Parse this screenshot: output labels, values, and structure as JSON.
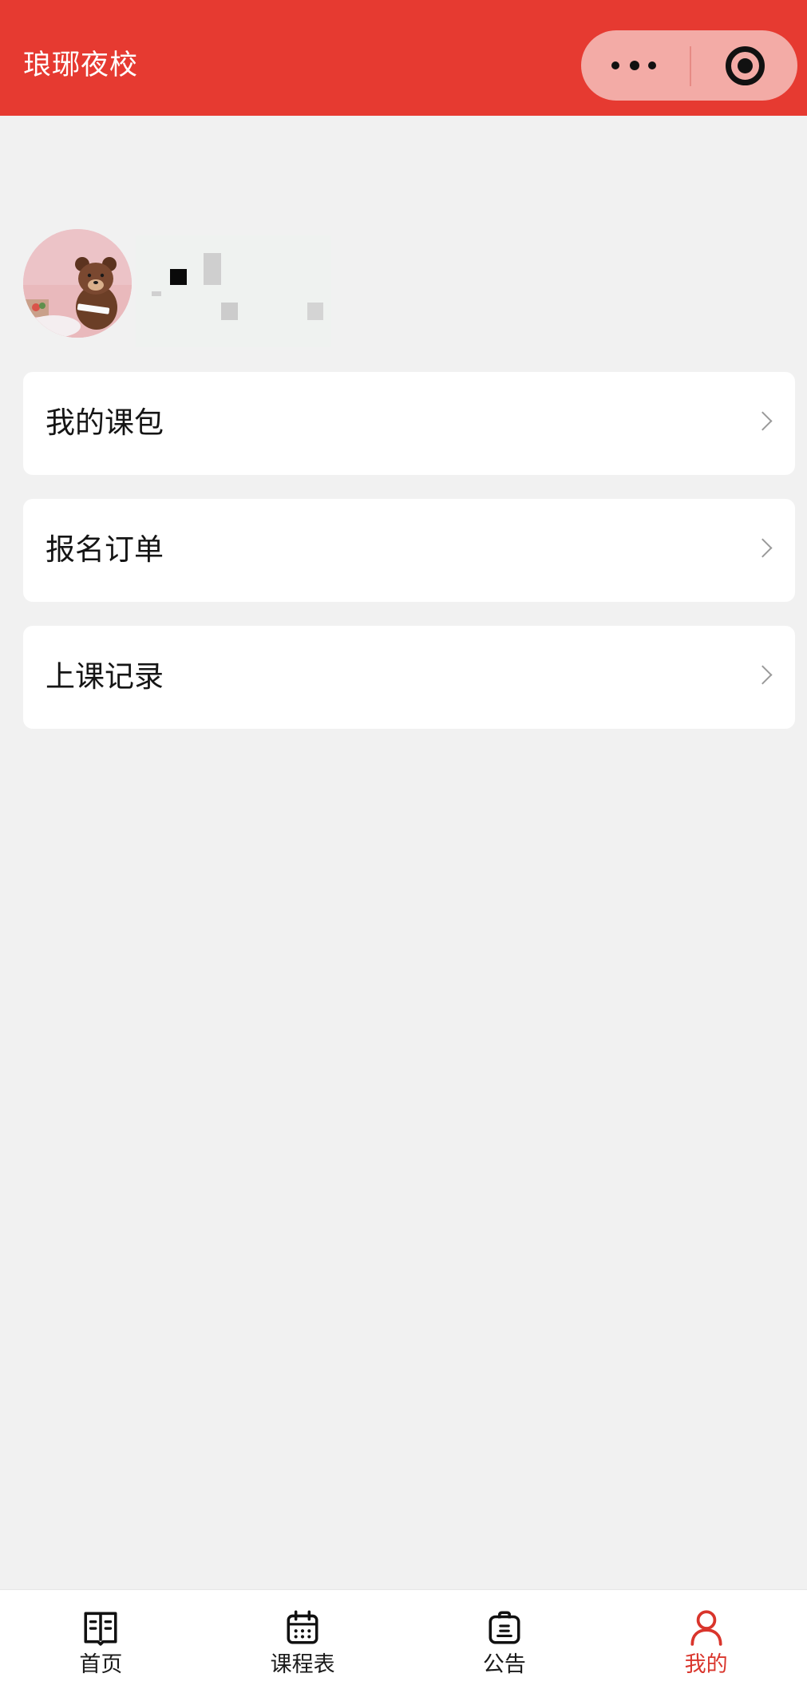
{
  "header": {
    "title": "琅琊夜校",
    "more_icon": "more-dots-icon",
    "target_icon": "target-circle-icon"
  },
  "profile": {
    "avatar_icon": "bear-avatar"
  },
  "menu": [
    {
      "label": "我的课包",
      "icon": "chevron-right-icon"
    },
    {
      "label": "报名订单",
      "icon": "chevron-right-icon"
    },
    {
      "label": "上课记录",
      "icon": "chevron-right-icon"
    }
  ],
  "tabbar": {
    "items": [
      {
        "label": "首页",
        "icon": "book-icon",
        "active": false
      },
      {
        "label": "课程表",
        "icon": "calendar-icon",
        "active": false
      },
      {
        "label": "公告",
        "icon": "clipboard-icon",
        "active": false
      },
      {
        "label": "我的",
        "icon": "person-icon",
        "active": true
      }
    ]
  },
  "colors": {
    "brand": "#e63a31",
    "active_tab": "#d9352c",
    "background": "#f1f1f1",
    "card": "#ffffff"
  }
}
